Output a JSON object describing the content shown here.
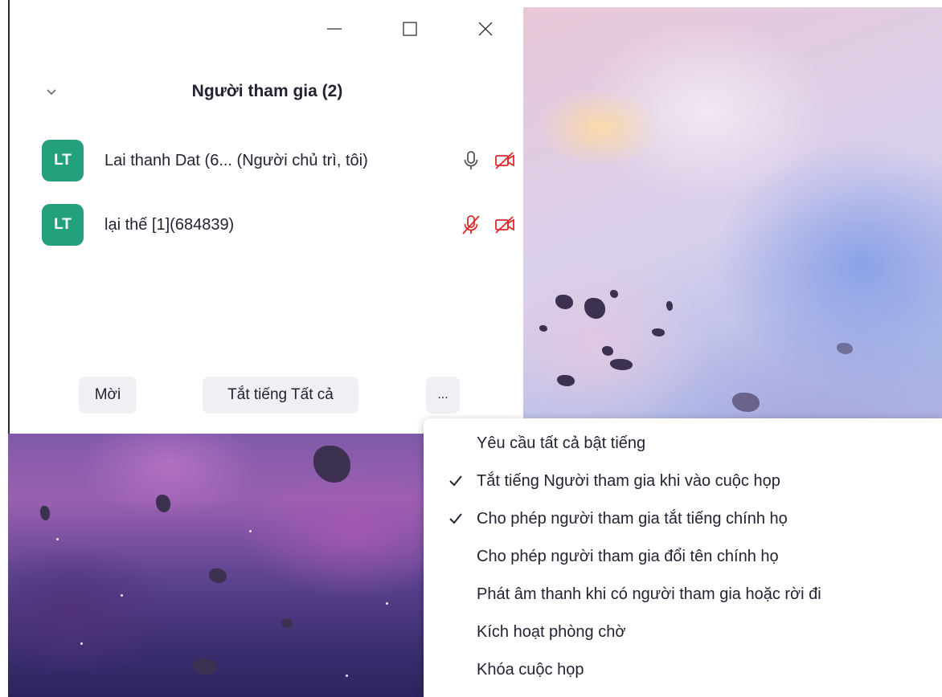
{
  "window": {
    "minimize_icon": "minimize-icon",
    "maximize_icon": "maximize-icon",
    "close_icon": "close-icon"
  },
  "panel": {
    "title": "Người tham gia (2)",
    "collapse_icon": "chevron-down-icon"
  },
  "participants": [
    {
      "initials": "LT",
      "name": "Lai thanh Dat (6... (Người chủ trì, tôi)",
      "mic": "mic-on",
      "video": "video-off"
    },
    {
      "initials": "LT",
      "name": "lại thế  [1](684839)",
      "mic": "mic-off",
      "video": "video-off"
    }
  ],
  "footer": {
    "invite": "Mời",
    "mute_all": "Tắt tiếng Tất cả",
    "more": "..."
  },
  "menu": {
    "items": [
      {
        "label": "Yêu cầu tất cả bật tiếng",
        "checked": false
      },
      {
        "label": "Tắt tiếng Người tham gia khi vào cuộc họp",
        "checked": true
      },
      {
        "label": "Cho phép người tham gia tắt tiếng chính họ",
        "checked": true
      },
      {
        "label": "Cho phép người tham gia đổi tên chính họ",
        "checked": false
      },
      {
        "label": "Phát âm thanh khi có người tham gia hoặc rời đi",
        "checked": false
      },
      {
        "label": "Kích hoạt phòng chờ",
        "checked": false
      },
      {
        "label": "Khóa cuộc họp",
        "checked": false
      }
    ]
  },
  "colors": {
    "avatar": "#23a07c",
    "muted_red": "#e02828",
    "text": "#232333",
    "button_bg": "#eff0f4"
  }
}
